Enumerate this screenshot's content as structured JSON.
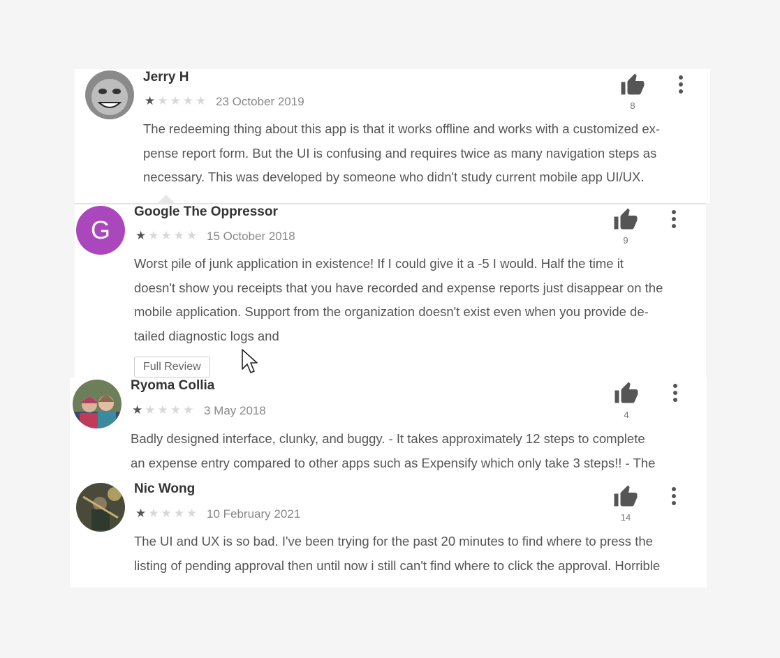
{
  "reviews": [
    {
      "name": "Jerry H",
      "date": "23 October 2019",
      "rating": 1,
      "likes": "8",
      "lines": [
        "The redeeming thing about this app is that it works offline and works with a customized ex-",
        "pense report form. But the UI is confusing and requires twice as many navigation steps as",
        "necessary. This was developed by someone who didn't study current mobile app UI/UX."
      ]
    },
    {
      "name": "Google The Oppressor",
      "avatar_letter": "G",
      "avatar_color": "#ab47bc",
      "date": "15 October 2018",
      "rating": 1,
      "likes": "9",
      "lines": [
        "Worst pile of junk application in existence! If I could give it a -5 I would. Half the time it",
        "doesn't show you receipts that you have recorded and expense reports just disappear on the",
        "mobile application. Support from the organization doesn't exist even when you provide de-",
        "tailed diagnostic logs and"
      ],
      "full_review_label": "Full Review"
    },
    {
      "name": "Ryoma Collia",
      "date": "3 May 2018",
      "rating": 1,
      "likes": "4",
      "lines": [
        "Badly designed interface, clunky, and buggy. - It takes approximately 12 steps to complete",
        "an expense entry compared to other apps such as Expensify which only take 3 steps!! - The"
      ]
    },
    {
      "name": "Nic Wong",
      "date": "10 February 2021",
      "rating": 1,
      "likes": "14",
      "lines": [
        "The UI and UX is so bad. I've been trying for the past 20 minutes to find where to press the",
        "listing of pending approval then until now i still can't find where to click the approval. Horrible"
      ]
    }
  ],
  "icons": {
    "like": "thumbs-up-icon",
    "more": "more-vertical-icon",
    "star": "star-icon",
    "cursor": "mouse-pointer-icon"
  }
}
